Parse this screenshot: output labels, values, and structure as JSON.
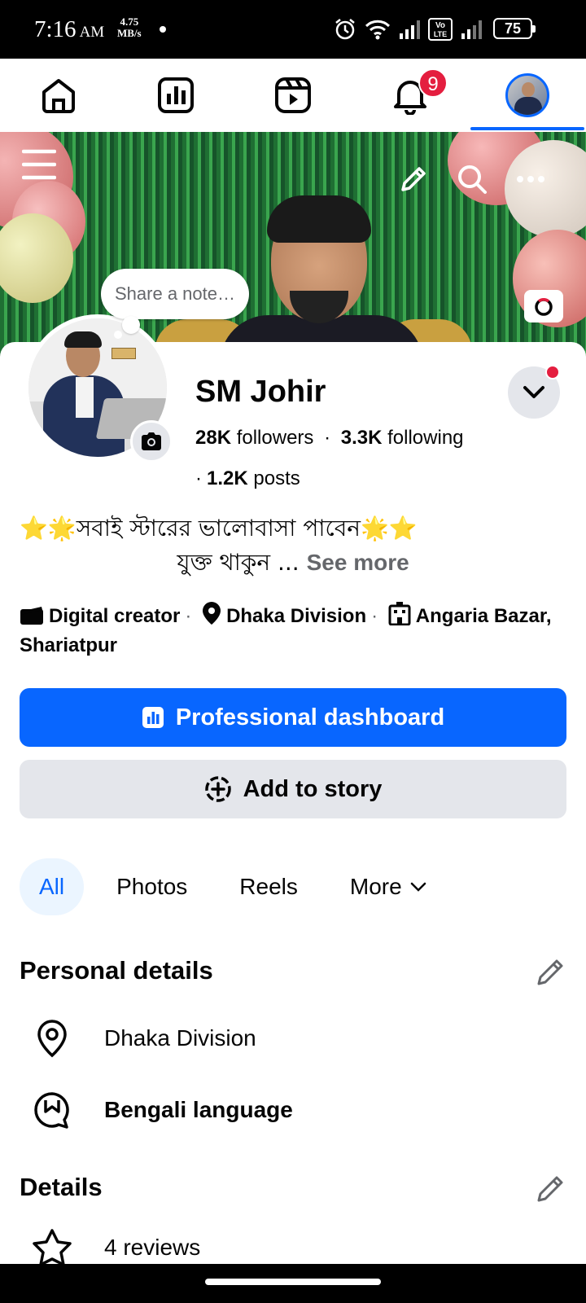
{
  "status_bar": {
    "time": "7:16",
    "ampm": "AM",
    "speed_value": "4.75",
    "speed_unit": "MB/s",
    "battery": "75",
    "icons": [
      "alarm-icon",
      "wifi-icon",
      "signal-icon",
      "volte-icon",
      "signal-icon"
    ]
  },
  "top_nav": {
    "items": [
      "home-icon",
      "dashboard-icon",
      "reels-icon",
      "notifications-icon",
      "profile-avatar"
    ],
    "notification_count": "9",
    "active_index": 4,
    "accent": "#0866ff",
    "badge_color": "#e41e3f"
  },
  "cover": {
    "note_placeholder": "Share a note…"
  },
  "profile": {
    "name": "SM Johir",
    "followers_count": "28K",
    "followers_label": "followers",
    "following_count": "3.3K",
    "following_label": "following",
    "posts_count": "1.2K",
    "posts_label": "posts",
    "bio_line1": "⭐🌟সবাই স্টারের ভালোবাসা পাবেন🌟⭐",
    "bio_line2": "যুক্ত থাকুন ...",
    "see_more": "See more",
    "category": "Digital creator",
    "location": "Dhaka Division",
    "place_line1": "Angaria Bazar,",
    "place_line2": "Shariatpur"
  },
  "buttons": {
    "professional_dashboard": "Professional dashboard",
    "add_to_story": "Add to story"
  },
  "tabs": {
    "all": "All",
    "photos": "Photos",
    "reels": "Reels",
    "more": "More"
  },
  "personal_details": {
    "title": "Personal details",
    "location": "Dhaka Division",
    "language": "Bengali language"
  },
  "details": {
    "title": "Details",
    "reviews": "4 reviews"
  }
}
